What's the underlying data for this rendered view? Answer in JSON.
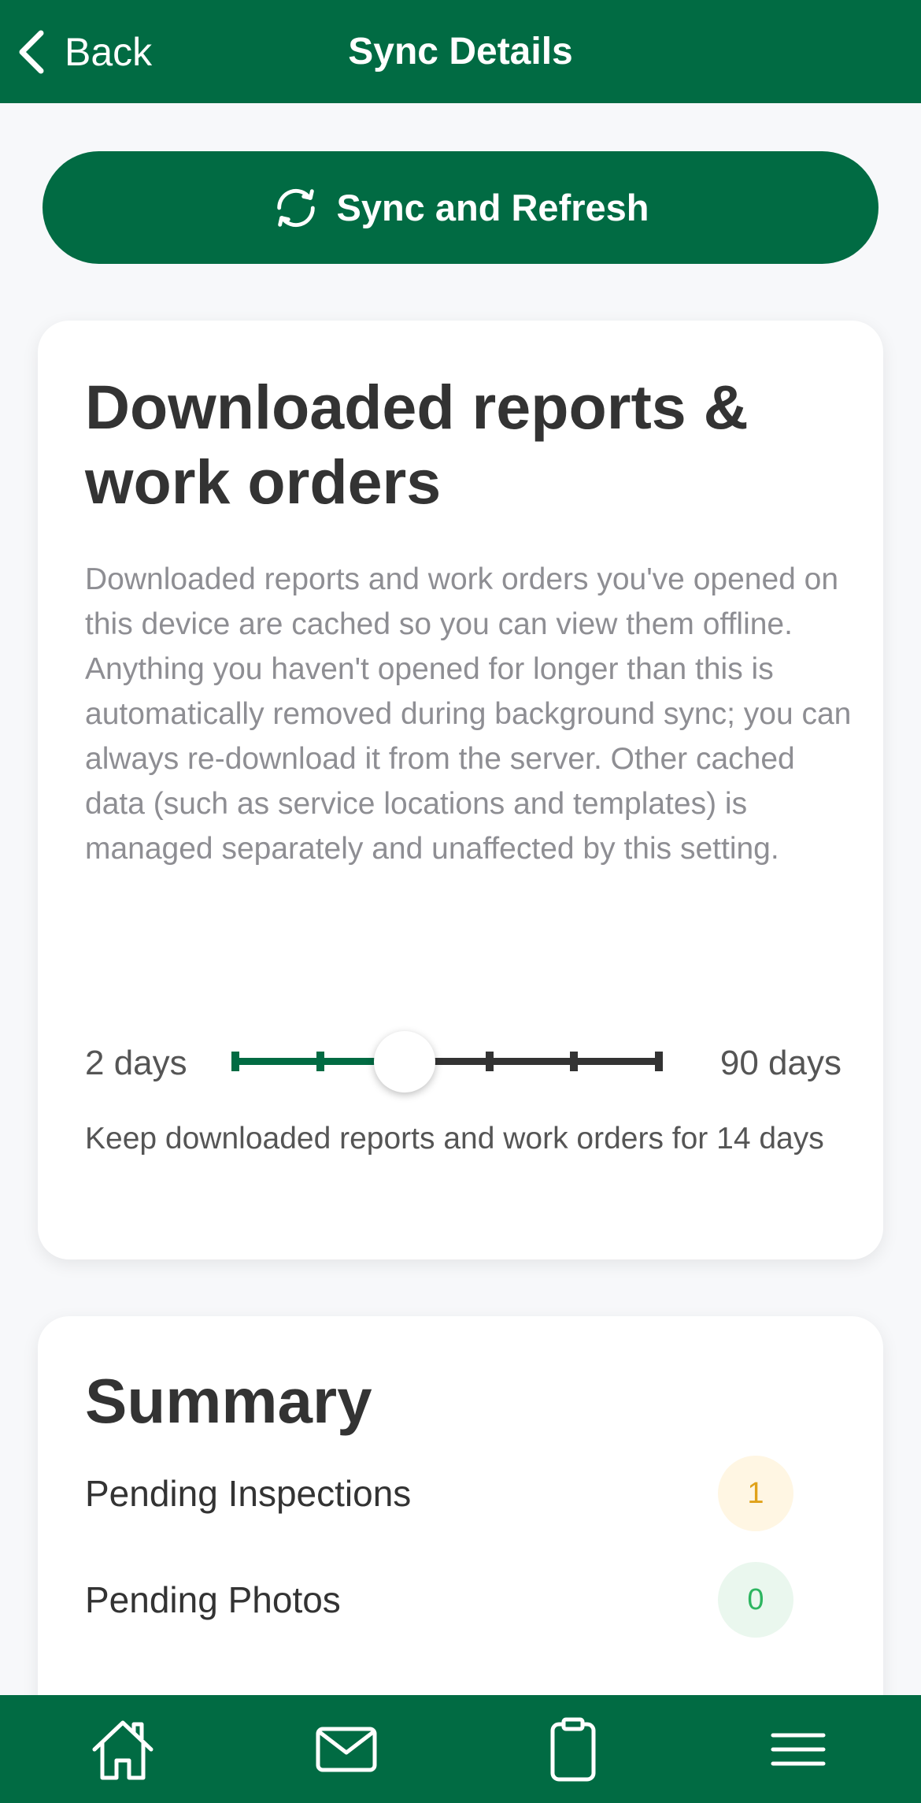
{
  "header": {
    "back_label": "Back",
    "title": "Sync Details"
  },
  "sync_button": {
    "label": "Sync and Refresh",
    "icon": "refresh-icon"
  },
  "retention": {
    "title": "Downloaded reports & work orders",
    "description": "Downloaded reports and work orders you've opened on this device are cached so you can view them offline. Anything you haven't opened for longer than this is automatically removed during background sync; you can always re-download it from the server. Other cached data (such as service locations and templates) is managed separately and unaffected by this setting.",
    "slider": {
      "min_label": "2 days",
      "max_label": "90 days",
      "steps": 6,
      "selected_step": 2,
      "selected_value_days": 14
    },
    "caption": "Keep downloaded reports and work orders for 14 days"
  },
  "summary": {
    "title": "Summary",
    "items": [
      {
        "label": "Pending Inspections",
        "count": "1",
        "status": "warning"
      },
      {
        "label": "Pending Photos",
        "count": "0",
        "status": "ok"
      }
    ]
  },
  "bottom_nav": {
    "items": [
      {
        "name": "home",
        "icon": "home-icon"
      },
      {
        "name": "messages",
        "icon": "mail-icon"
      },
      {
        "name": "reports",
        "icon": "clipboard-icon"
      },
      {
        "name": "menu",
        "icon": "menu-icon"
      }
    ]
  },
  "colors": {
    "brand_green": "#016B43",
    "background": "#F7F8FA",
    "card": "#FFFFFF",
    "warning_text": "#E0A21A",
    "warning_bg": "#FFF6E3",
    "ok_text": "#2DB560",
    "ok_bg": "#EAF7EE"
  }
}
